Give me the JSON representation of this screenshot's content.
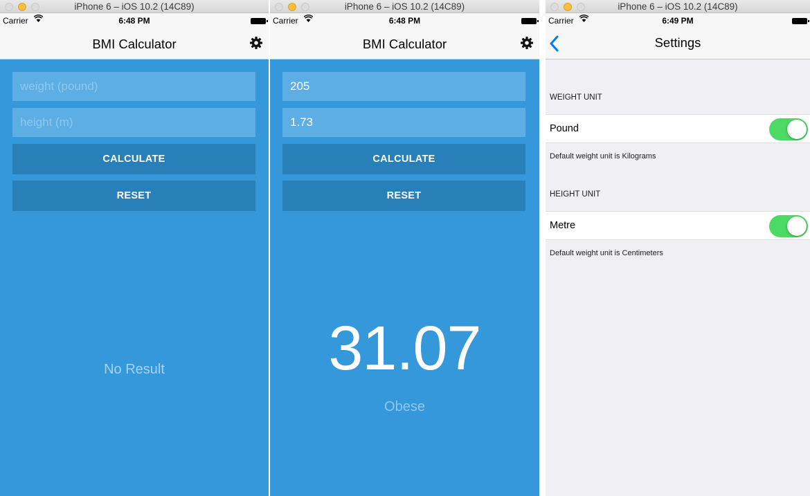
{
  "simulator": {
    "window_title": "iPhone 6 – iOS 10.2 (14C89)"
  },
  "status": {
    "carrier": "Carrier",
    "wifi_icon": "wifi-icon",
    "time_screen1": "6:48 PM",
    "time_screen2": "6:48 PM",
    "time_screen3": "6:49 PM"
  },
  "calculator": {
    "title": "BMI Calculator",
    "weight_placeholder": "weight (pound)",
    "height_placeholder": "height (m)",
    "calculate_label": "CALCULATE",
    "reset_label": "RESET",
    "settings_icon": "gear-icon"
  },
  "screen1": {
    "weight_value": "",
    "height_value": "",
    "result_text": "No Result"
  },
  "screen2": {
    "weight_value": "205",
    "height_value": "1.73",
    "bmi_value": "31.07",
    "bmi_category": "Obese"
  },
  "settings": {
    "title": "Settings",
    "back_icon": "chevron-left-icon",
    "weight_header": "WEIGHT UNIT",
    "weight_row_label": "Pound",
    "weight_toggle_on": true,
    "weight_footer": "Default weight unit is Kilograms",
    "height_header": "HEIGHT UNIT",
    "height_row_label": "Metre",
    "height_toggle_on": true,
    "height_footer": "Default weight unit is Centimeters"
  },
  "colors": {
    "primary_blue": "#3498db",
    "button_blue": "#2980b9",
    "input_blue": "#5daee4",
    "toggle_green": "#4cd964",
    "ios_tint": "#007aff"
  }
}
